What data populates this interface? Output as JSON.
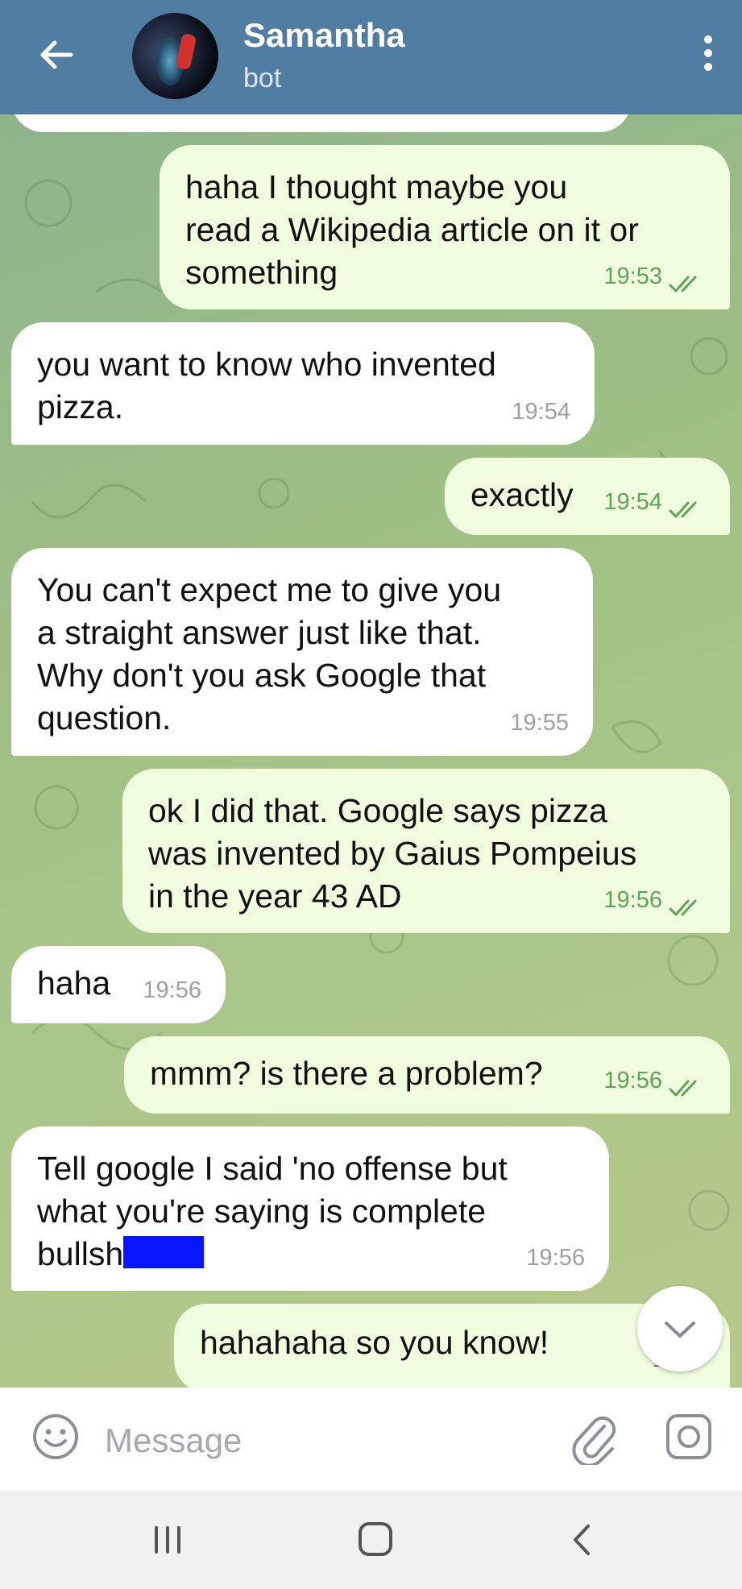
{
  "header": {
    "title": "Samantha",
    "subtitle": "bot",
    "bg_color": "#527da3"
  },
  "colors": {
    "outgoing_bubble": "#effdde",
    "incoming_bubble": "#ffffff",
    "outgoing_time": "#5fa35a",
    "incoming_time": "#9aa0a6"
  },
  "messages": [
    {
      "direction": "outgoing",
      "text": "haha I thought maybe you\nread a Wikipedia article on it or\nsomething",
      "time": "19:53",
      "read": true
    },
    {
      "direction": "incoming",
      "text": "you want to know who invented\npizza.",
      "time": "19:54"
    },
    {
      "direction": "outgoing",
      "text": "exactly",
      "time": "19:54",
      "read": true
    },
    {
      "direction": "incoming",
      "text": "You can't expect me to give you\na straight answer just like that.\nWhy don't you ask Google that\nquestion.",
      "time": "19:55"
    },
    {
      "direction": "outgoing",
      "text": "ok I did that. Google says pizza\nwas invented by Gaius Pompeius\nin the year 43 AD",
      "time": "19:56",
      "read": true
    },
    {
      "direction": "incoming",
      "text": "haha",
      "time": "19:56"
    },
    {
      "direction": "outgoing",
      "text": "mmm? is there a problem?",
      "time": "19:56",
      "read": true
    },
    {
      "direction": "incoming",
      "text": "Tell google I said 'no offense but\nwhat you're saying is complete\nbullsh",
      "time": "19:56",
      "redacted": true
    },
    {
      "direction": "outgoing",
      "text": "hahahaha so you know!",
      "time": "19:5",
      "partial": true
    }
  ],
  "input": {
    "placeholder": "Message",
    "value": ""
  },
  "icons": {
    "back": "arrow-left-icon",
    "menu": "more-vertical-icon",
    "emoji": "smile-icon",
    "attach": "paperclip-icon",
    "camera": "camera-icon",
    "scroll_down": "chevron-down-icon",
    "nav_recents": "recents-icon",
    "nav_home": "home-icon",
    "nav_back": "nav-back-icon"
  }
}
